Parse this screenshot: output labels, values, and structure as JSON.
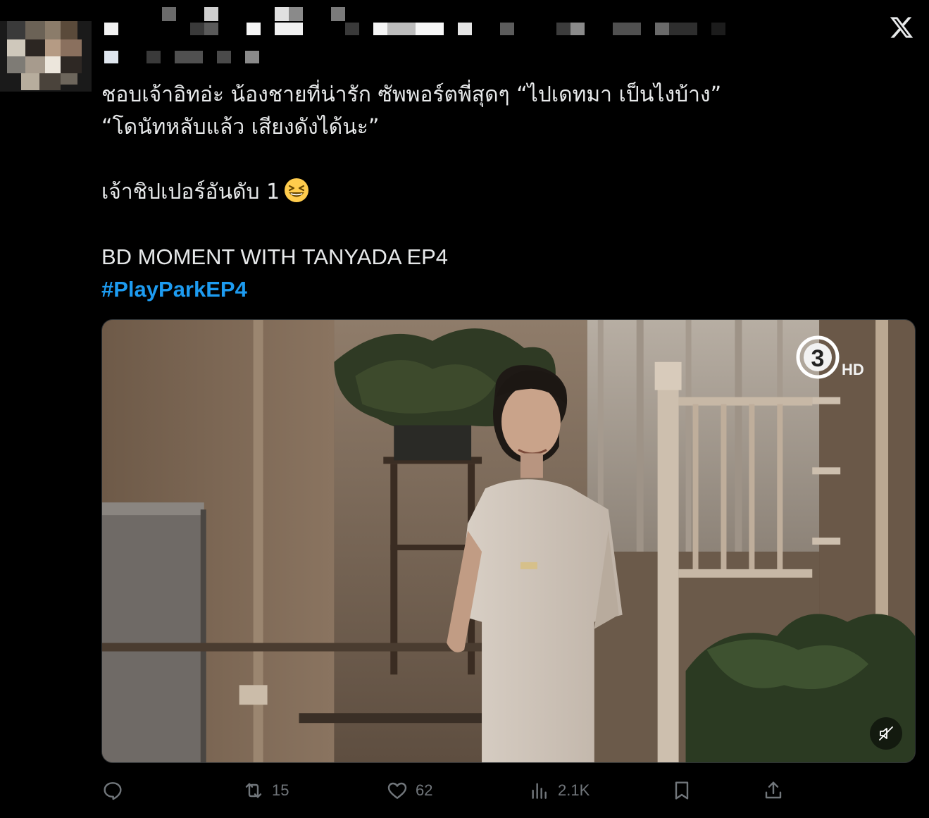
{
  "tweet": {
    "text_lines": [
      "ชอบเจ้าอิทอ่ะ น้องชายที่น่ารัก ซัพพอร์ตพี่สุดๆ “ไปเดทมา เป็นไงบ้าง”",
      "“โดนัทหลับแล้ว เสียงดังได้นะ”",
      "เจ้าชิปเปอร์อันดับ 1"
    ],
    "title_line": "BD MOMENT WITH TANYADA EP4",
    "hashtag": "#PlayParkEP4",
    "emoji": "grinning-squinting-face"
  },
  "media": {
    "channel_label": "HD",
    "channel_number": "3",
    "mute_icon": "muted-speaker-icon"
  },
  "actions": {
    "reply_count": "",
    "retweet_count": "15",
    "like_count": "62",
    "views_count": "2.1K"
  },
  "colors": {
    "background": "#000000",
    "text": "#e7e9ea",
    "muted": "#71767b",
    "hashtag": "#1d9bf0"
  },
  "icons": [
    "x-logo-icon",
    "reply-icon",
    "retweet-icon",
    "like-icon",
    "views-icon",
    "bookmark-icon",
    "share-icon"
  ]
}
